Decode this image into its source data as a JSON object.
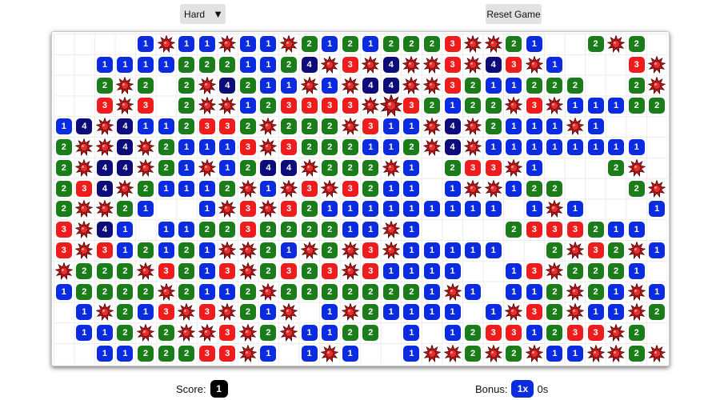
{
  "toolbar": {
    "difficulty_label": "Hard",
    "difficulty_arrow": "▼",
    "reset_label": "Reset Game"
  },
  "footer": {
    "score_label": "Score:",
    "score_value": "1",
    "bonus_label": "Bonus:",
    "bonus_multiplier": "1x",
    "bonus_time": "0s"
  },
  "colors": {
    "n1": "#0a2bdf",
    "n2": "#1a7d1a",
    "n3": "#ee1c1c",
    "n4": "#0c0c7a",
    "mine": "#c81414"
  },
  "icons": {
    "mine": "mine-icon",
    "dropdown": "chevron-down-icon"
  },
  "board": {
    "cols": 30,
    "rows": 16,
    "legend": "space = closed/empty cell, 1-4 = revealed number, * = mine, X = exploded mine",
    "grid": [
      "    1*11*11*21212223**21  2*2",
      "  11112221124*3*4**3*43*1   3*4",
      "  2*2 2*4211*1*44**3211222  2**",
      "  3*3 2**123333*X32122*3*1112222",
      "14*4112332*222*311*4*2111*1  ",
      "2**4*21113*3222112*4*11111111",
      "2*44*21*1244*222*1 233*1   2*",
      "234*21112*1*3*3211 1**122   2*",
      "2**21  1*3*32111111111 1*1   11",
      "3*41 11223222211*1    2333211",
      "3*312121**21*2*3*11111  2*32*1",
      "*222*3213*2323*31111  13*2221",
      "12222*2112*22222221*1 112*21*1",
      " 1*213*3*21* 1*21111 1*32*11*21",
      " 112*2**3*2*1122 1 12331233*2",
      "  1122233*1 1*1  1**2*2*11**2*"
    ]
  }
}
